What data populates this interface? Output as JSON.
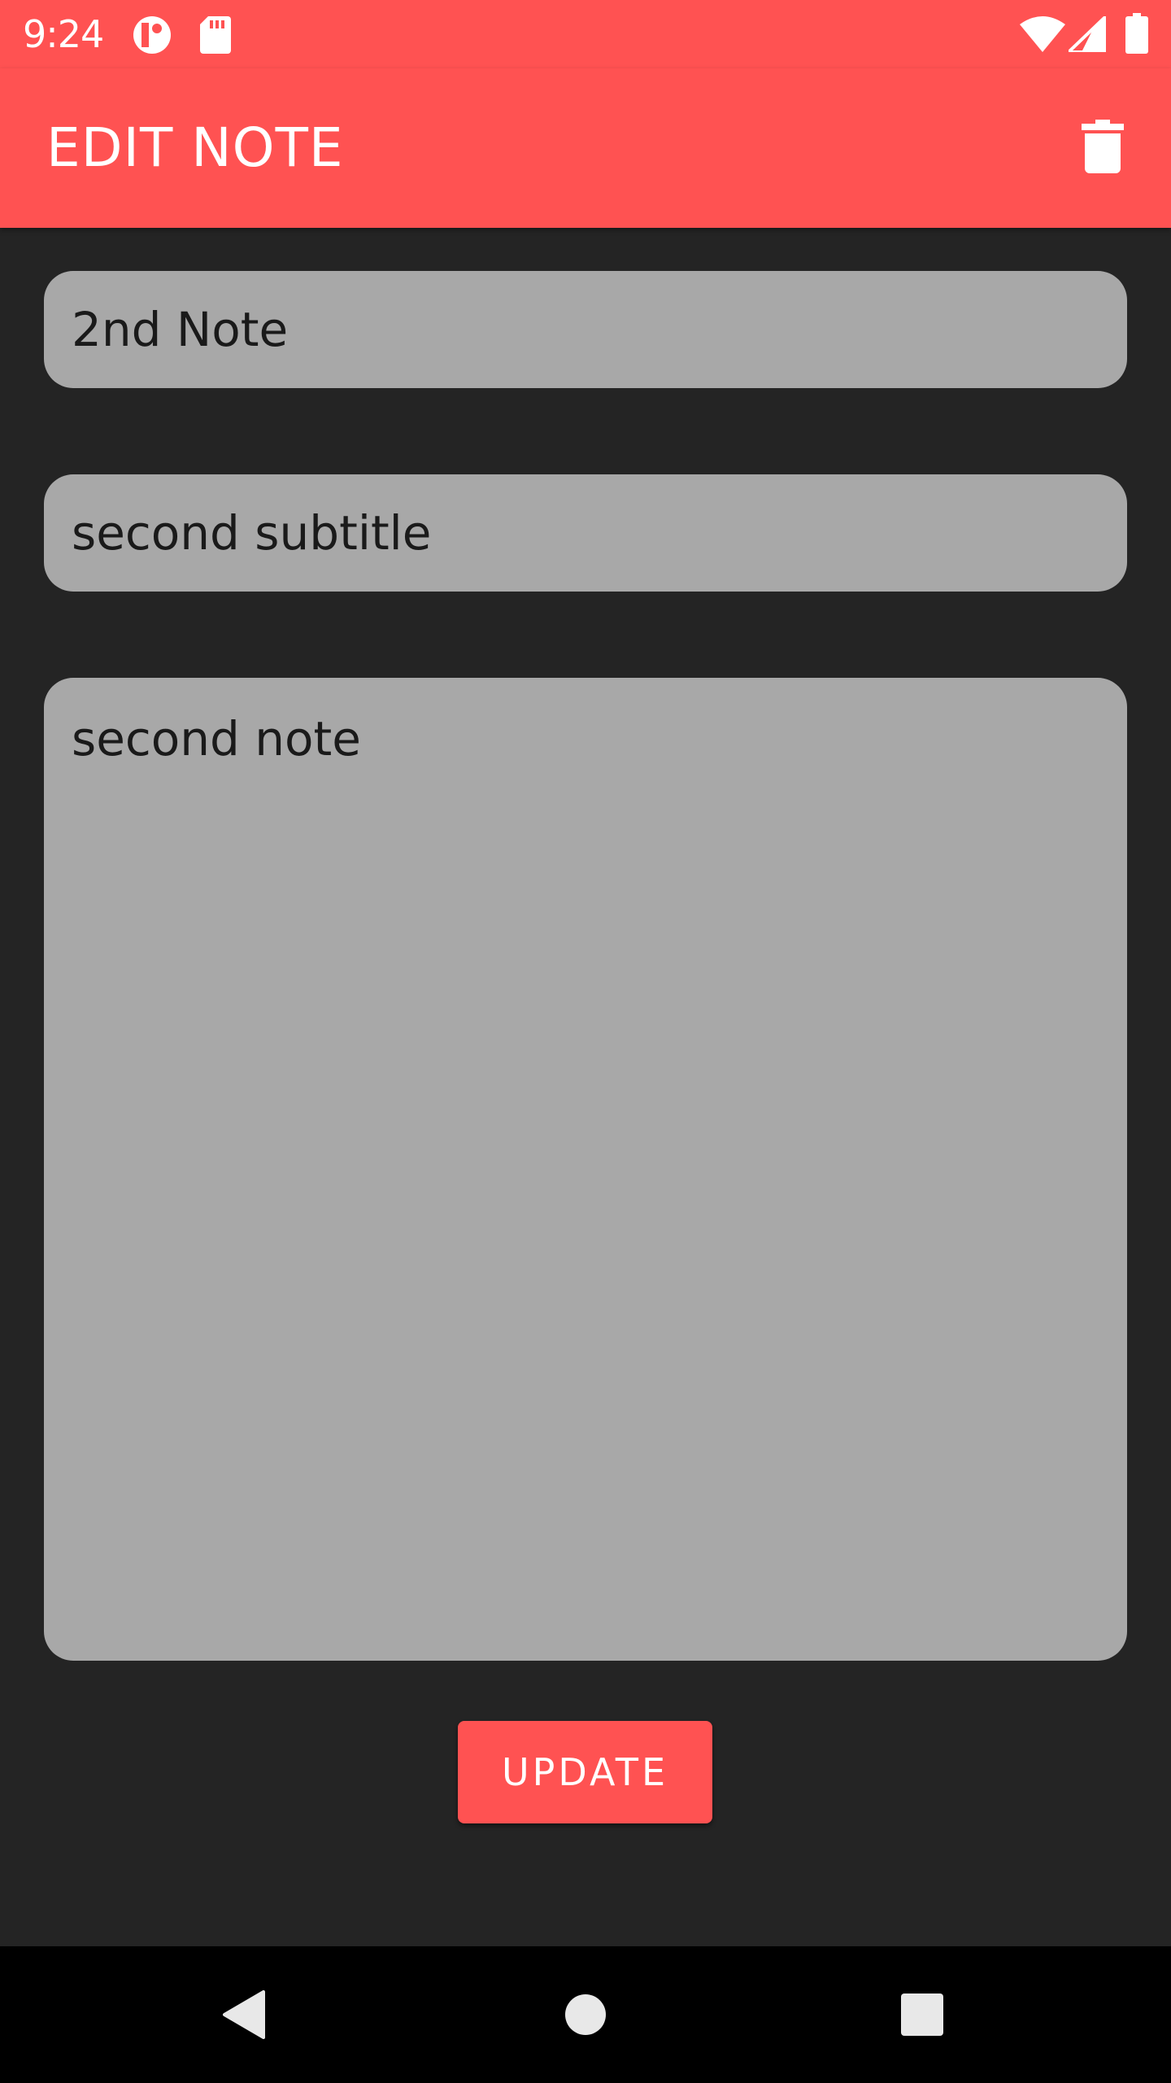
{
  "status_bar": {
    "time": "9:24",
    "icons": [
      "record-icon",
      "sd-card-icon",
      "wifi-icon",
      "cell-signal-icon",
      "battery-icon"
    ]
  },
  "app_bar": {
    "title": "EDIT NOTE",
    "action_icon": "trash-icon"
  },
  "form": {
    "title_value": "2nd Note",
    "subtitle_value": "second subtitle",
    "note_value": "second note",
    "update_label": "UPDATE"
  },
  "nav_bar": {
    "icons": [
      "back-icon",
      "home-icon",
      "recents-icon"
    ]
  },
  "colors": {
    "accent": "#ff5252",
    "background": "#242424",
    "field": "#a8a8a8",
    "nav": "#000000"
  }
}
